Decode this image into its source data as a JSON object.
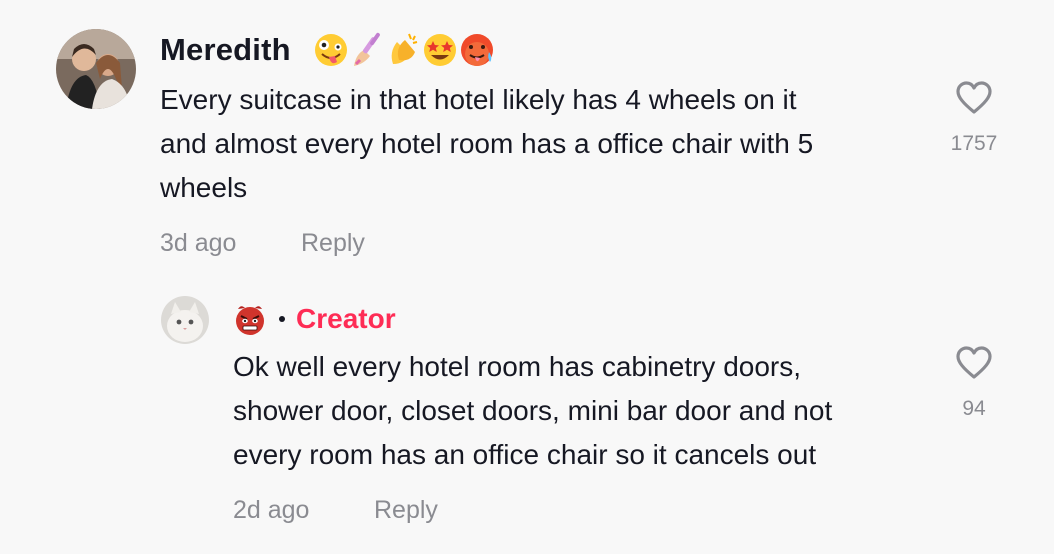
{
  "comment": {
    "username": "Meredith",
    "username_emojis": [
      "zany-face",
      "nail-polish",
      "clapping-hands",
      "star-struck",
      "hot-face"
    ],
    "text_lines": [
      "Every suitcase in that hotel likely has 4 wheels on it",
      "and almost every hotel room has a office chair with 5",
      "wheels"
    ],
    "time": "3d ago",
    "reply_label": "Reply",
    "likes": "1757"
  },
  "reply": {
    "username_emoji": "angry-devil",
    "badge": "Creator",
    "text_lines": [
      "Ok well every hotel room has cabinetry doors,",
      "shower door, closet doors, mini bar door and not",
      "every room has an office chair so it cancels out"
    ],
    "time": "2d ago",
    "reply_label": "Reply",
    "likes": "94"
  },
  "colors": {
    "background": "#f8f8f8",
    "text": "#161823",
    "muted": "#8a8b91",
    "creator": "#fe2c55"
  }
}
